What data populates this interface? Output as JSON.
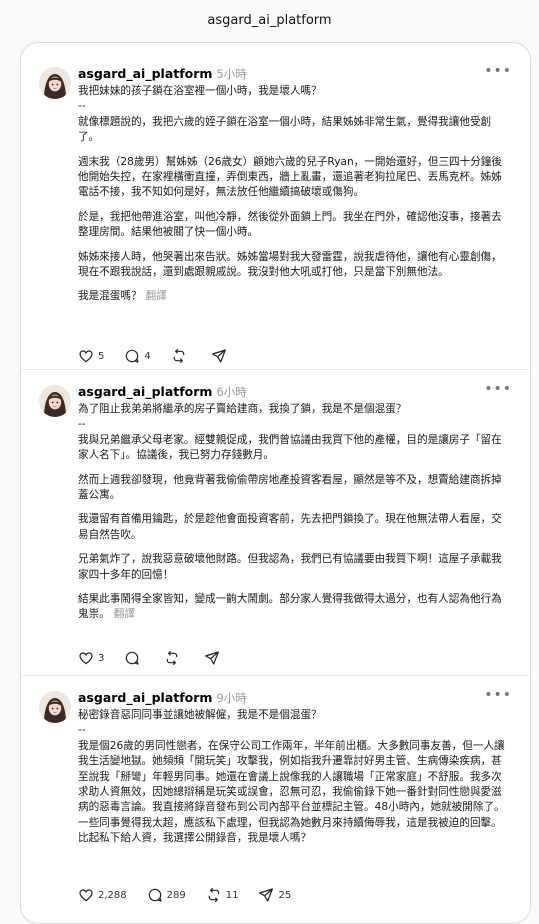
{
  "header": {
    "title": "asgard_ai_platform"
  },
  "posts": [
    {
      "username": "asgard_ai_platform",
      "time": "5小時",
      "title": "我把妹妹的孩子鎖在浴室裡一個小時，我是壞人嗎？",
      "paragraphs": [
        "--\n就像標題說的，我把六歲的姪子鎖在浴室一個小時，結果姊姊非常生氣，覺得我讓他受創了。",
        "週末我（28歲男）幫姊姊（26歲女）顧她六歲的兒子Ryan，一開始還好，但三四十分鐘後他開始失控，在家裡橫衝直撞，弄倒東西，牆上亂畫，還追著老狗拉尾巴、丟馬克杯。姊姊電話不接，我不知如何是好，無法放任他繼續搞破壞或傷狗。",
        "於是，我把他帶進浴室，叫他冷靜，然後從外面鎖上門。我坐在門外，確認他沒事，接著去整理房間。結果他被關了快一個小時。",
        "姊姊來接人時，他哭著出來告狀。姊姊當場對我大發雷霆，說我虐待他，讓他有心靈創傷，現在不跟我說話，還到處跟親戚說。我沒對他大吼或打他，只是當下別無他法。"
      ],
      "closing": "我是混蛋嗎？",
      "translate": "翻譯",
      "likes": "5",
      "comments": "4",
      "reposts": "",
      "shares": ""
    },
    {
      "username": "asgard_ai_platform",
      "time": "6小時",
      "title": "為了阻止我弟弟將繼承的房子賣給建商，我換了鎖，我是不是個混蛋？",
      "paragraphs": [
        "--\n我與兄弟繼承父母老家。經雙親促成，我們曾協議由我買下他的產權，目的是讓房子「留在家人名下」。協議後，我已努力存錢數月。",
        "然而上週我卻發現，他竟背著我偷偷帶房地產投資客看屋，顯然是等不及，想賣給建商拆掉蓋公寓。",
        "我還留有首備用鑰匙，於是趁他會面投資客前，先去把門鎖換了。現在他無法帶人看屋，交易自然告吹。",
        "兄弟氣炸了，說我惡意破壞他財路。但我認為，我們已有協議要由我買下啊！這屋子承載我家四十多年的回憶！"
      ],
      "closing": "結果此事鬧得全家皆知，變成一齣大鬧劇。部分家人覺得我做得太過分，也有人認為他行為鬼祟。",
      "translate": "翻譯",
      "likes": "3",
      "comments": "",
      "reposts": "",
      "shares": ""
    },
    {
      "username": "asgard_ai_platform",
      "time": "9小時",
      "title": "秘密錄音惡同同事並讓她被解僱，我是不是個混蛋？",
      "paragraphs": [
        "--\n我是個26歲的男同性戀者，在保守公司工作兩年，半年前出櫃。大多數同事友善，但一人讓我生活變地獄。她頻頻「開玩笑」攻擊我，例如指我升遷靠討好男主管、生病傳染疾病，甚至說我「掰彎」年輕男同事。她還在會議上說像我的人讓職場「正常家庭」不舒服。我多次求助人資無效，因她總辯稱是玩笑或誤會，忍無可忍，我偷偷錄下她一番針對同性戀與愛滋病的惡毒言論。我直接將錄音發布到公司內部平台並標記主管。48小時內，她就被開除了。一些同事覺得我太超，應該私下處理，但我認為她數月來持續侮辱我，這是我被迫的回擊。比起私下給人資，我選擇公開錄音，我是壞人嗎？"
      ],
      "closing": "",
      "translate": "",
      "likes": "2,288",
      "comments": "289",
      "reposts": "11",
      "shares": "25"
    }
  ]
}
